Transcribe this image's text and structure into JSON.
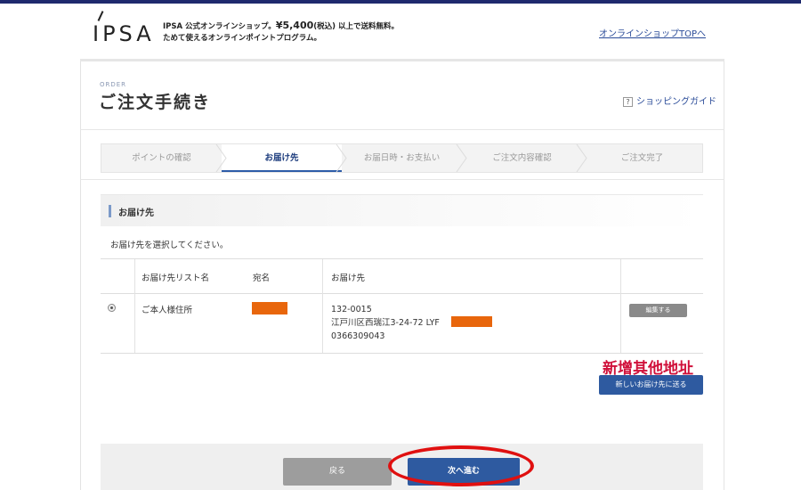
{
  "header": {
    "logo_text": "IPSA",
    "tagline_line1_prefix": "IPSA 公式オンラインショップ。",
    "tagline_price": "¥5,400",
    "tagline_tax": "(税込)",
    "tagline_line1_suffix": " 以上で送料無料。",
    "tagline_line2": "ためて使えるオンラインポイントプログラム。",
    "shop_top_link": "オンラインショップTOPへ"
  },
  "page": {
    "order_label": "ORDER",
    "title": "ご注文手続き",
    "guide_icon": "?",
    "guide_link": "ショッピングガイド"
  },
  "steps": [
    {
      "label": "ポイントの確認",
      "active": false
    },
    {
      "label": "お届け先",
      "active": true
    },
    {
      "label": "お届日時・お支払い",
      "active": false
    },
    {
      "label": "ご注文内容確認",
      "active": false
    },
    {
      "label": "ご注文完了",
      "active": false
    }
  ],
  "section": {
    "title": "お届け先",
    "instruction": "お届け先を選択してください。"
  },
  "table": {
    "headers": [
      "お届け先リスト名",
      "宛名",
      "お届け先"
    ],
    "rows": [
      {
        "list_name": "ご本人様住所",
        "postal": "132-0015",
        "address": "江戸川区西瑞江3-24-72 LYF",
        "phone": "0366309043",
        "edit_label": "編集する"
      }
    ]
  },
  "annotation_text": "新增其他地址",
  "new_address_button": "新しいお届け先に送る",
  "footer": {
    "back_button": "戻る",
    "next_button": "次へ進む"
  },
  "colors": {
    "accent": "#2e5aa0",
    "redaction": "#e8660c",
    "annotation": "#d0103a",
    "highlight": "#e01010"
  }
}
